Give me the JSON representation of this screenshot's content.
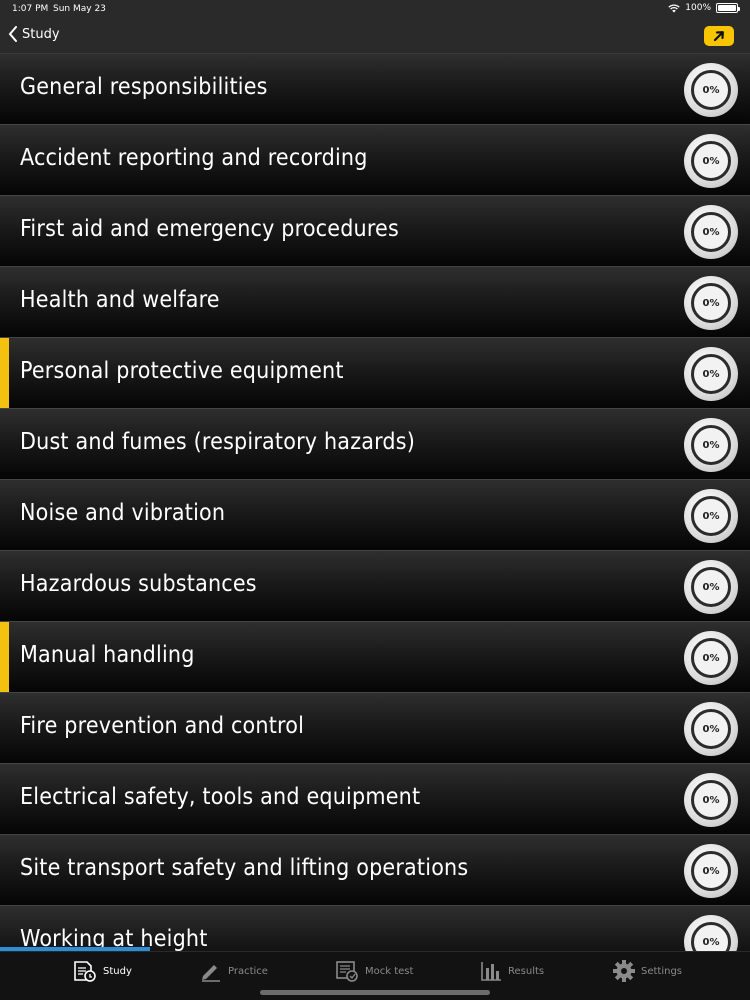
{
  "status_bar": {
    "time": "1:07 PM",
    "date": "Sun May 23",
    "battery": "100%"
  },
  "nav": {
    "back_label": "Study",
    "share_icon": "share-arrow-icon",
    "accent": "#f7c600"
  },
  "topics": [
    {
      "title": "General responsibilities",
      "progress": "0%",
      "marked": false
    },
    {
      "title": "Accident reporting and recording",
      "progress": "0%",
      "marked": false
    },
    {
      "title": "First aid and emergency procedures",
      "progress": "0%",
      "marked": false
    },
    {
      "title": "Health and welfare",
      "progress": "0%",
      "marked": false
    },
    {
      "title": "Personal protective equipment",
      "progress": "0%",
      "marked": true
    },
    {
      "title": "Dust and fumes (respiratory hazards)",
      "progress": "0%",
      "marked": false
    },
    {
      "title": "Noise and vibration",
      "progress": "0%",
      "marked": false
    },
    {
      "title": "Hazardous substances",
      "progress": "0%",
      "marked": false
    },
    {
      "title": "Manual handling",
      "progress": "0%",
      "marked": true
    },
    {
      "title": "Fire prevention and control",
      "progress": "0%",
      "marked": false
    },
    {
      "title": "Electrical safety, tools and equipment",
      "progress": "0%",
      "marked": false
    },
    {
      "title": "Site transport safety and lifting operations",
      "progress": "0%",
      "marked": false
    },
    {
      "title": "Working at height",
      "progress": "0%",
      "marked": false
    }
  ],
  "tabs": [
    {
      "label": "Study",
      "icon": "study-book-icon",
      "active": true
    },
    {
      "label": "Practice",
      "icon": "pencil-icon",
      "active": false
    },
    {
      "label": "Mock test",
      "icon": "mock-test-icon",
      "active": false
    },
    {
      "label": "Results",
      "icon": "bar-chart-icon",
      "active": false
    },
    {
      "label": "Settings",
      "icon": "gear-icon",
      "active": false
    }
  ],
  "colors": {
    "marker": "#f3c10f",
    "scroll_indicator": "#2a8fd6"
  }
}
